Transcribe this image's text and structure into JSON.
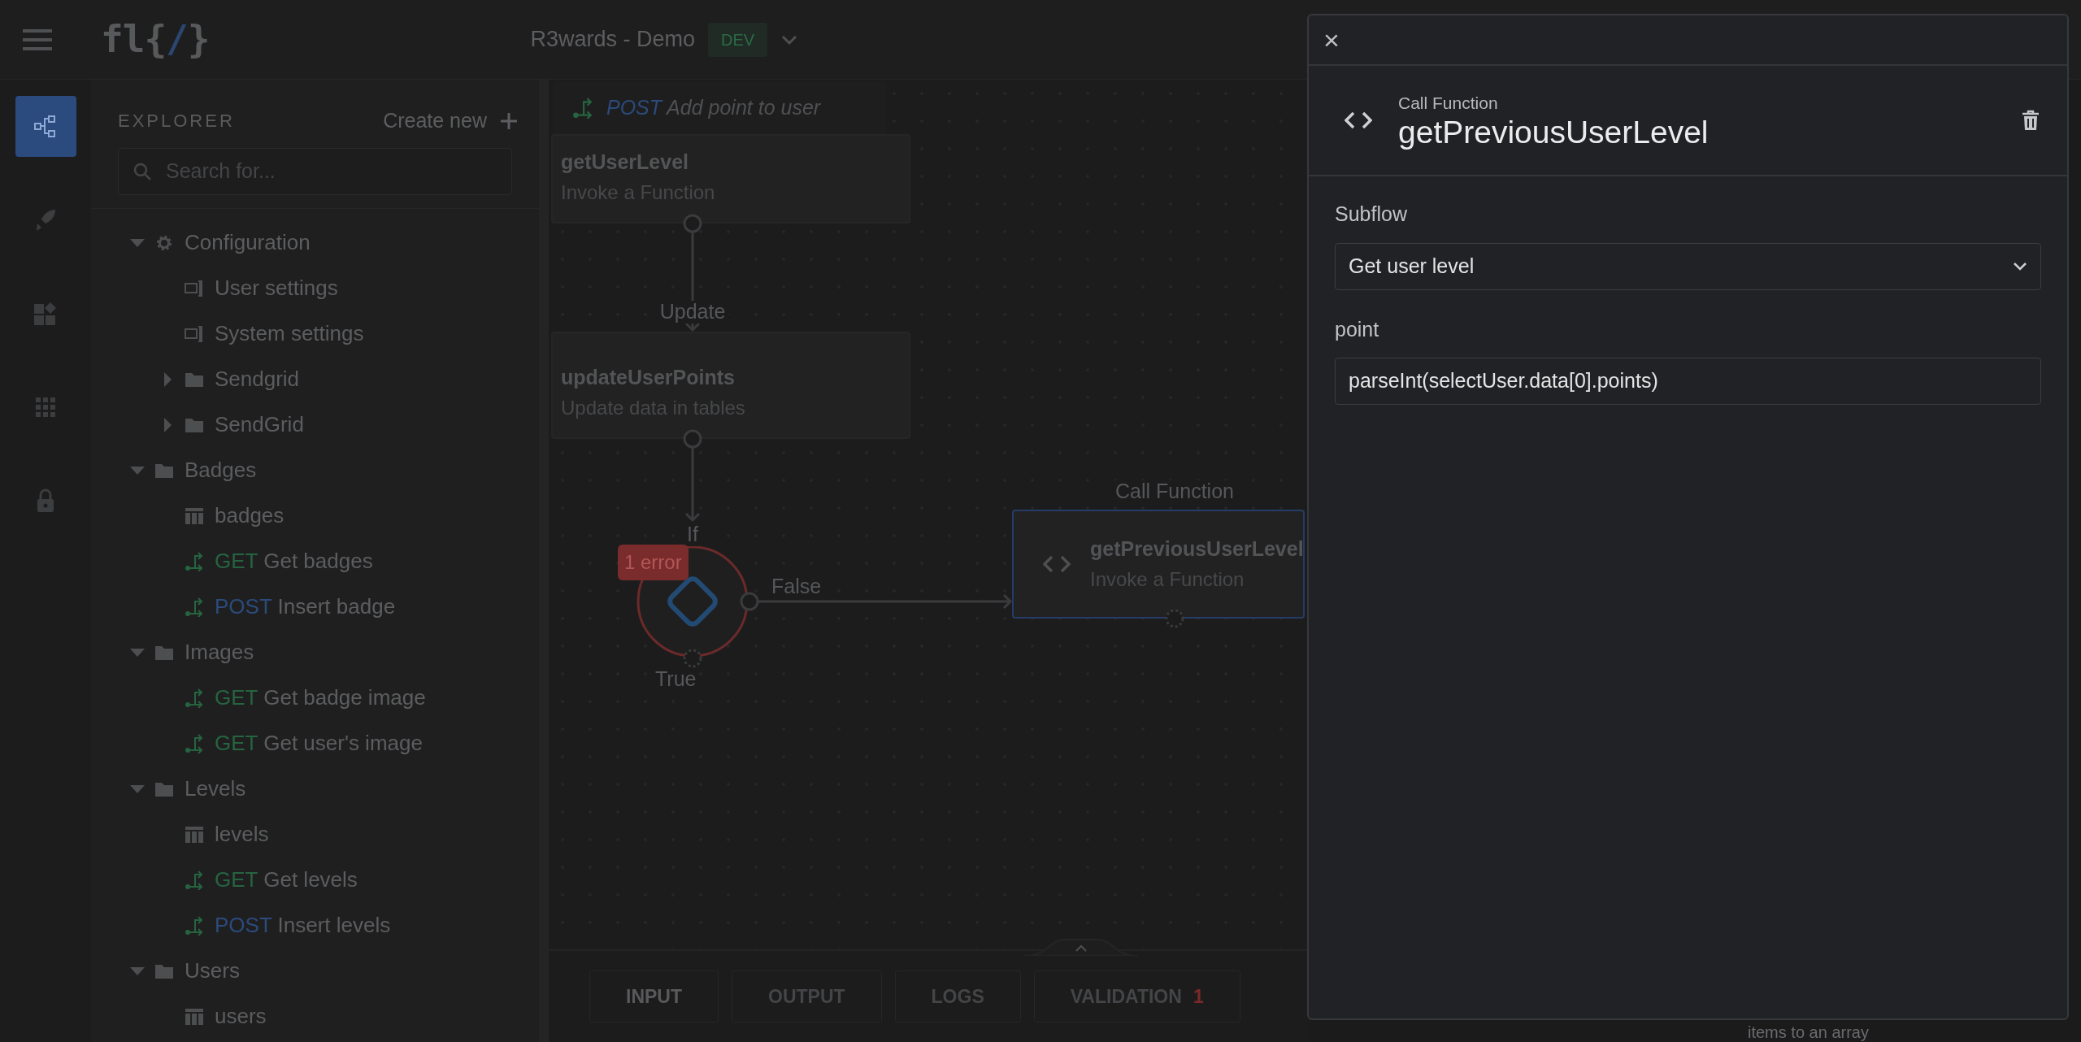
{
  "header": {
    "logo_parts": [
      "fl{",
      "/",
      "}"
    ],
    "app_name": "R3wards - Demo",
    "environment": "DEV"
  },
  "rail": [
    {
      "kind": "flow",
      "selected": true
    },
    {
      "kind": "rocket",
      "selected": false
    },
    {
      "kind": "widgets",
      "selected": false
    },
    {
      "kind": "grid",
      "selected": false
    },
    {
      "kind": "lock",
      "selected": false
    }
  ],
  "explorer": {
    "title": "EXPLORER",
    "create_label": "Create new",
    "search_placeholder": "Search for...",
    "tree": [
      {
        "kind": "config",
        "label": "Configuration",
        "expanded": true,
        "children": [
          {
            "kind": "settings",
            "label": "User settings"
          },
          {
            "kind": "settings",
            "label": "System settings"
          },
          {
            "kind": "folder",
            "label": "Sendgrid",
            "expanded": false
          },
          {
            "kind": "folder",
            "label": "SendGrid",
            "expanded": false
          }
        ]
      },
      {
        "kind": "folder",
        "label": "Badges",
        "expanded": true,
        "children": [
          {
            "kind": "table",
            "label": "badges"
          },
          {
            "kind": "endpoint",
            "method": "GET",
            "label": "Get badges"
          },
          {
            "kind": "endpoint",
            "method": "POST",
            "label": "Insert badge"
          }
        ]
      },
      {
        "kind": "folder",
        "label": "Images",
        "expanded": true,
        "children": [
          {
            "kind": "endpoint",
            "method": "GET",
            "label": "Get badge image"
          },
          {
            "kind": "endpoint",
            "method": "GET",
            "label": "Get user's image"
          }
        ]
      },
      {
        "kind": "folder",
        "label": "Levels",
        "expanded": true,
        "children": [
          {
            "kind": "table",
            "label": "levels"
          },
          {
            "kind": "endpoint",
            "method": "GET",
            "label": "Get levels"
          },
          {
            "kind": "endpoint",
            "method": "POST",
            "label": "Insert levels"
          }
        ]
      },
      {
        "kind": "folder",
        "label": "Users",
        "expanded": true,
        "children": [
          {
            "kind": "table",
            "label": "users"
          }
        ]
      }
    ]
  },
  "canvas": {
    "tab": {
      "method": "POST",
      "label": "Add point to user"
    },
    "nodes": [
      {
        "kind": "step",
        "title": "getUserLevel",
        "subtitle": "Invoke a Function",
        "selected": false
      },
      {
        "kind": "step",
        "type_label": "Update",
        "title": "updateUserPoints",
        "subtitle": "Update data in tables",
        "selected": false
      },
      {
        "kind": "condition",
        "type_label": "If",
        "badge": "1 error",
        "false_label": "False",
        "true_label": "True",
        "selected": false
      },
      {
        "kind": "function",
        "type_label": "Call Function",
        "title": "getPreviousUserLevel",
        "subtitle": "Invoke a Function",
        "selected": true
      }
    ],
    "bottom_tabs": [
      {
        "label": "INPUT",
        "selected": true
      },
      {
        "label": "OUTPUT",
        "selected": false
      },
      {
        "label": "LOGS",
        "selected": false
      },
      {
        "label": "VALIDATION",
        "count": "1",
        "selected": false
      }
    ],
    "side_note": "items to an array"
  },
  "drawer": {
    "close": "×",
    "type_label": "Call Function",
    "title": "getPreviousUserLevel",
    "fields": [
      {
        "kind": "select",
        "label": "Subflow",
        "value": "Get user level"
      },
      {
        "kind": "text",
        "label": "point",
        "value": "parseInt(selectUser.data[0].points)"
      }
    ]
  }
}
